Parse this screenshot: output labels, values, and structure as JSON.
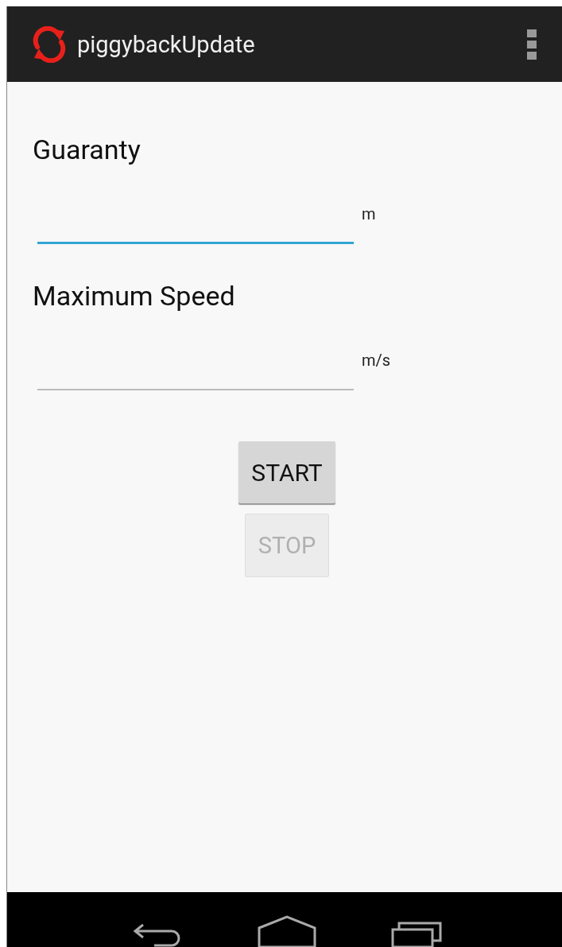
{
  "action_bar": {
    "title": "piggybackUpdate"
  },
  "fields": [
    {
      "label": "Guaranty",
      "unit": "m",
      "focused": true
    },
    {
      "label": "Maximum Speed",
      "unit": "m/s",
      "focused": false
    }
  ],
  "buttons": [
    {
      "label": "START",
      "disabled": false
    },
    {
      "label": "STOP",
      "disabled": true
    }
  ]
}
